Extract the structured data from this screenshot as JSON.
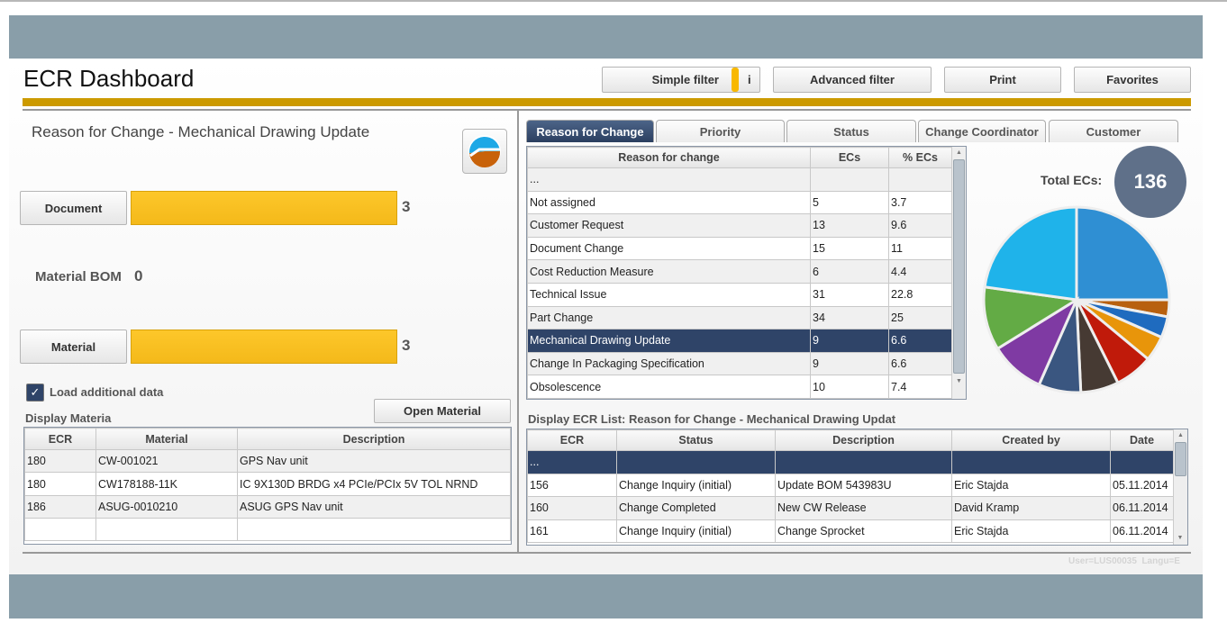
{
  "header": {
    "title": "ECR Dashboard",
    "buttons": {
      "simple_filter": "Simple filter",
      "info": "i",
      "advanced_filter": "Advanced filter",
      "print": "Print",
      "favorites": "Favorites"
    }
  },
  "left": {
    "title": "Reason for Change - Mechanical Drawing Update",
    "chart_icon": "pie-chart-icon",
    "document": {
      "label": "Document",
      "value": "3"
    },
    "material_bom": {
      "label": "Material BOM",
      "value": "0"
    },
    "material": {
      "label": "Material",
      "value": "3"
    },
    "load_additional": {
      "label": "Load additional data",
      "checked": true
    },
    "display_material_label": "Display Materia",
    "open_material": "Open Material",
    "material_table": {
      "columns": [
        "ECR",
        "Material",
        "Description"
      ],
      "rows": [
        [
          "180",
          "CW-001021",
          "GPS Nav unit"
        ],
        [
          "180",
          "CW178188-11K",
          "IC 9X130D BRDG x4 PCIe/PCIx 5V TOL NRND"
        ],
        [
          "186",
          "ASUG-0010210",
          "ASUG GPS Nav unit"
        ]
      ]
    }
  },
  "tabs": [
    "Reason for Change",
    "Priority",
    "Status",
    "Change Coordinator",
    "Customer"
  ],
  "reason_table": {
    "columns": [
      "Reason for change",
      "ECs",
      "% ECs"
    ],
    "rows": [
      [
        "...",
        "",
        ""
      ],
      [
        "Not assigned",
        "5",
        "3.7"
      ],
      [
        "Customer Request",
        "13",
        "9.6"
      ],
      [
        "Document Change",
        "15",
        "11"
      ],
      [
        "Cost Reduction Measure",
        "6",
        "4.4"
      ],
      [
        "Technical Issue",
        "31",
        "22.8"
      ],
      [
        "Part Change",
        "34",
        "25"
      ],
      [
        "Mechanical Drawing Update",
        "9",
        "6.6"
      ],
      [
        "Change In Packaging Specification",
        "9",
        "6.6"
      ],
      [
        "Obsolescence",
        "10",
        "7.4"
      ]
    ],
    "selected": 7
  },
  "total": {
    "label": "Total ECs:",
    "value": "136"
  },
  "pie": {
    "values": [
      34,
      4,
      5,
      6,
      9,
      9,
      10,
      13,
      15,
      31
    ],
    "colors": [
      "#2f8fd3",
      "#b8600f",
      "#1f6bbf",
      "#e8950a",
      "#c01a0a",
      "#463a33",
      "#3a5680",
      "#7f3aa3",
      "#63ab45",
      "#1fb3ea"
    ]
  },
  "ecr_list": {
    "title": "Display ECR List: Reason for Change - Mechanical Drawing Updat",
    "columns": [
      "ECR",
      "Status",
      "Description",
      "Created by",
      "Date"
    ],
    "rows": [
      [
        "...",
        "",
        "",
        "",
        ""
      ],
      [
        "156",
        "Change Inquiry (initial)",
        "Update BOM 543983U",
        "Eric Stajda",
        "05.11.2014"
      ],
      [
        "160",
        "Change Completed",
        "New CW Release",
        "David Kramp",
        "06.11.2014"
      ],
      [
        "161",
        "Change Inquiry (initial)",
        "Change Sprocket",
        "Eric Stajda",
        "06.11.2014"
      ]
    ],
    "selected": 0
  },
  "status": "User=LUS00035  Langu=E"
}
